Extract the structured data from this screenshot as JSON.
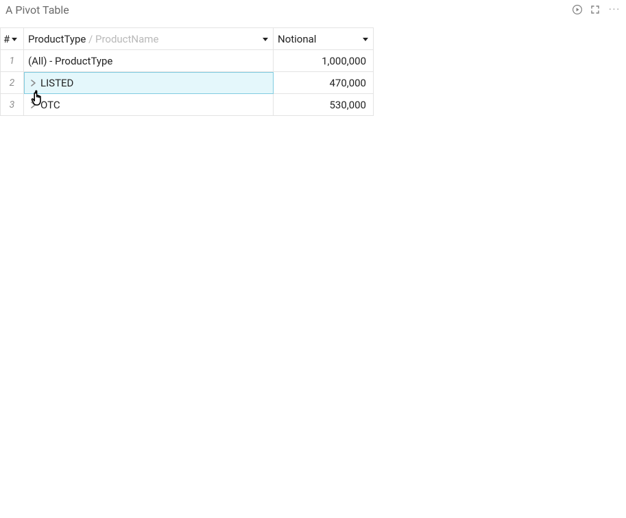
{
  "title": "A Pivot Table",
  "header": {
    "index_symbol": "#",
    "dimension": {
      "primary": "ProductType",
      "separator": " / ",
      "secondary": "ProductName"
    },
    "measure": "Notional"
  },
  "rows": [
    {
      "idx": "1",
      "label": "(All) - ProductType",
      "expandable": false,
      "notional": "1,000,000"
    },
    {
      "idx": "2",
      "label": "LISTED",
      "expandable": true,
      "notional": "470,000",
      "selected": true
    },
    {
      "idx": "3",
      "label": "OTC",
      "expandable": true,
      "notional": "530,000"
    }
  ],
  "icons": {
    "play": "play-circle",
    "expand": "fullscreen",
    "more": "···"
  }
}
